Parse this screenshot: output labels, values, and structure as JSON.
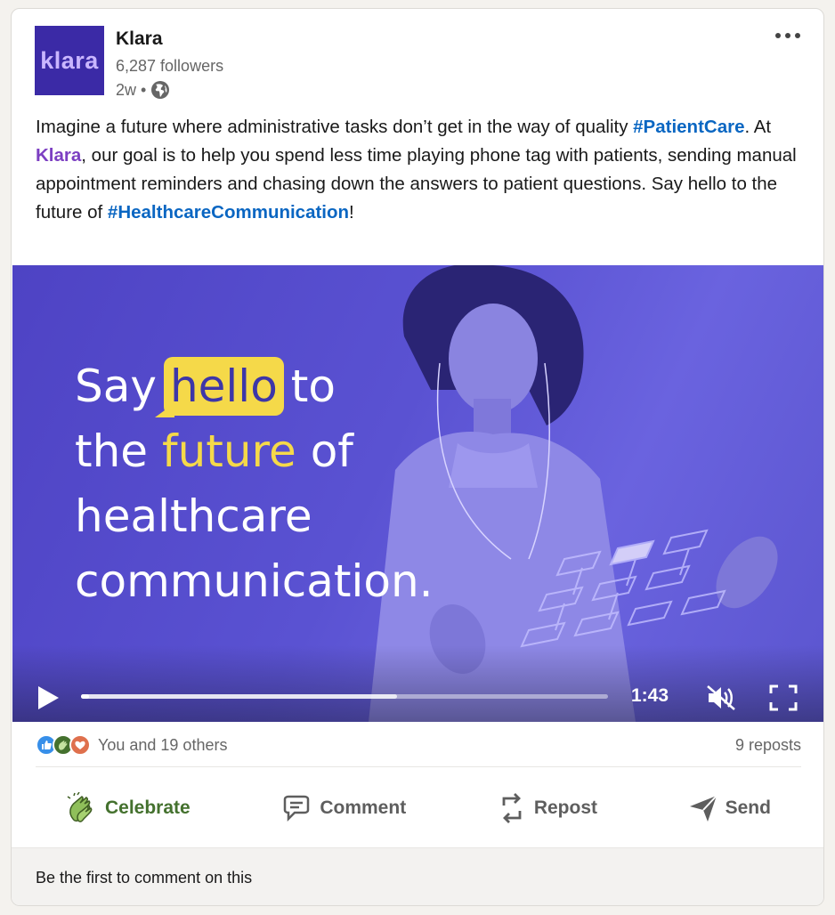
{
  "post": {
    "author": {
      "logo_text": "klara",
      "name": "Klara",
      "followers": "6,287 followers",
      "time": "2w",
      "separator": "•",
      "visibility_icon": "globe-icon"
    },
    "more_icon": "ellipsis-icon",
    "text": {
      "p1": "Imagine a future where administrative tasks don’t get in the way of quality ",
      "hashtag1": "#PatientCare",
      "p2": ". At ",
      "mention": "Klara",
      "p3": ", our goal is to help you spend less time playing phone tag with patients, sending manual appointment reminders and chasing down the answers to patient questions. Say hello to the future of ",
      "hashtag2": "#HealthcareCommunication",
      "p4": "!"
    },
    "video": {
      "overlay": {
        "say": "Say",
        "hello": "hello",
        "to": "to",
        "the": "the",
        "future": "future",
        "of": "of",
        "line3": "healthcare",
        "line4": "communication."
      },
      "duration": "1:43",
      "progress_played": 0.015,
      "progress_buffered": 0.6,
      "muted": true
    },
    "social": {
      "reactions": [
        "like-icon",
        "celebrate-icon",
        "love-icon"
      ],
      "reactors": "You and 19 others",
      "reposts": "9 reposts"
    },
    "actions": {
      "celebrate": "Celebrate",
      "comment": "Comment",
      "repost": "Repost",
      "send": "Send"
    },
    "footer": "Be the first to comment on this"
  },
  "colors": {
    "brand": "#3b2aa6",
    "hashtag": "#0a66c2",
    "mention": "#7c3fc2",
    "celebrate_active": "#44712e",
    "video_bg": "#5a52d2",
    "highlight": "#f5d949"
  }
}
